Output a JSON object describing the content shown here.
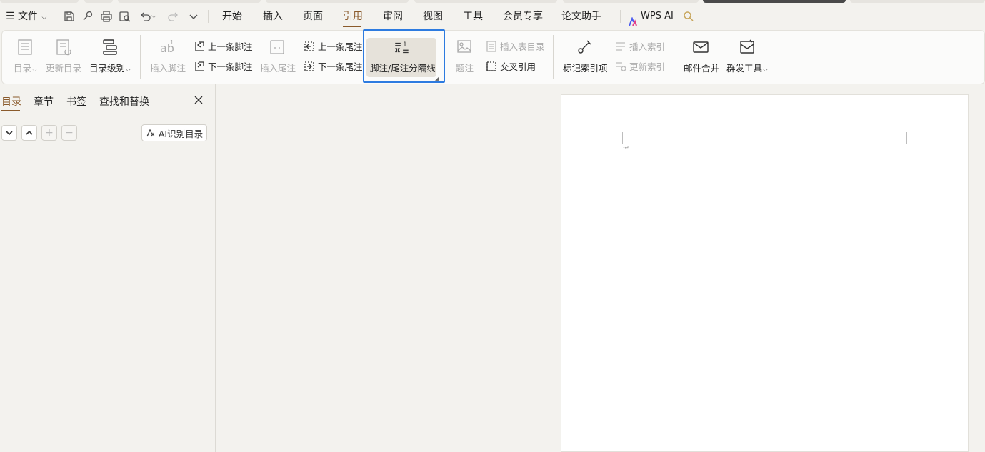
{
  "menubar": {
    "hamburger_label": "文件",
    "tabs": [
      "开始",
      "插入",
      "页面",
      "引用",
      "审阅",
      "视图",
      "工具",
      "会员专享",
      "论文助手"
    ],
    "active_tab": "引用",
    "wps_ai": "WPS AI"
  },
  "ribbon": {
    "toc": "目录",
    "update_toc": "更新目录",
    "toc_level": "目录级别",
    "insert_footnote": "插入脚注",
    "prev_footnote": "上一条脚注",
    "next_footnote": "下一条脚注",
    "insert_endnote": "插入尾注",
    "prev_endnote": "上一条尾注",
    "next_endnote": "下一条尾注",
    "separator": "脚注/尾注分隔线",
    "caption": "题注",
    "insert_table_toc": "插入表目录",
    "cross_ref": "交叉引用",
    "mark_index": "标记索引项",
    "insert_index": "插入索引",
    "update_index": "更新索引",
    "mail_merge": "邮件合并",
    "bulk_send": "群发工具"
  },
  "navpane": {
    "tabs": [
      "目录",
      "章节",
      "书签",
      "查找和替换"
    ],
    "active_tab": "目录",
    "ai_button": "AI识别目录"
  },
  "colors": {
    "accent": "#8a5a2b",
    "highlight": "#2d7be0",
    "background": "#f3f2ee"
  }
}
